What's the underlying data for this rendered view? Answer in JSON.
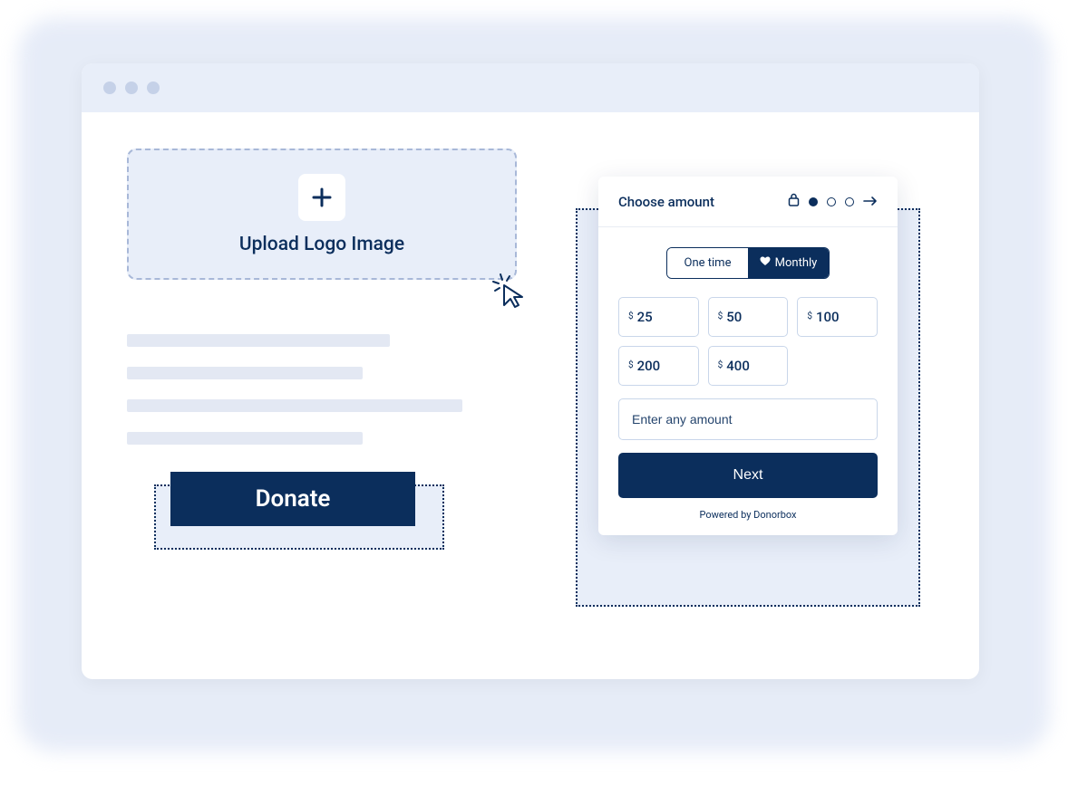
{
  "editor": {
    "upload_label": "Upload Logo Image",
    "donate_button_label": "Donate"
  },
  "widget": {
    "header_title": "Choose amount",
    "frequency": {
      "one_time": "One time",
      "monthly": "Monthly"
    },
    "amounts": {
      "currency": "$",
      "a1": "25",
      "a2": "50",
      "a3": "100",
      "a4": "200",
      "a5": "400"
    },
    "custom_placeholder": "Enter any amount",
    "next_label": "Next",
    "powered_by": "Powered by Donorbox"
  }
}
